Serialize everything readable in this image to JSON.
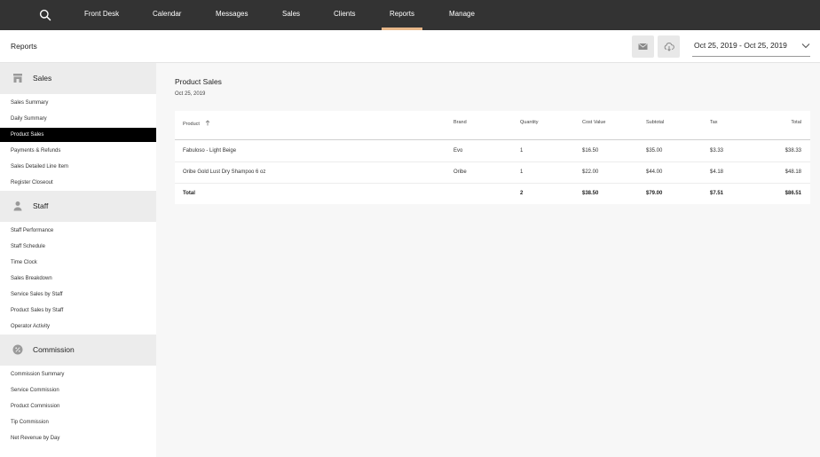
{
  "nav": {
    "items": [
      {
        "label": "Front Desk",
        "active": false
      },
      {
        "label": "Calendar",
        "active": false
      },
      {
        "label": "Messages",
        "active": false
      },
      {
        "label": "Sales",
        "active": false
      },
      {
        "label": "Clients",
        "active": false
      },
      {
        "label": "Reports",
        "active": true
      },
      {
        "label": "Manage",
        "active": false
      }
    ],
    "accent_color": "#e8b88a",
    "background_color": "#333333"
  },
  "header": {
    "title": "Reports",
    "date_range": "Oct 25, 2019 - Oct 25, 2019"
  },
  "sidebar": {
    "sections": [
      {
        "label": "Sales",
        "icon": "store-icon",
        "items": [
          "Sales Summary",
          "Daily Summary",
          "Product Sales",
          "Payments & Refunds",
          "Sales Detailed Line Item",
          "Register Closeout"
        ]
      },
      {
        "label": "Staff",
        "icon": "person-icon",
        "items": [
          "Staff Performance",
          "Staff Schedule",
          "Time Clock",
          "Sales Breakdown",
          "Service Sales by Staff",
          "Product Sales by Staff",
          "Operator Activity"
        ]
      },
      {
        "label": "Commission",
        "icon": "percent-icon",
        "items": [
          "Commission Summary",
          "Service Commission",
          "Product Commission",
          "Tip Commission",
          "Net Revenue by Day"
        ]
      }
    ],
    "active_item": "Product Sales"
  },
  "report": {
    "title": "Product Sales",
    "date": "Oct 25, 2019",
    "columns": [
      "Product",
      "Brand",
      "Quantity",
      "Cost Value",
      "Subtotal",
      "Tax",
      "Total"
    ],
    "rows": [
      [
        "Fabuloso - Light Beige",
        "Evo",
        "1",
        "$16.50",
        "$35.00",
        "$3.33",
        "$38.33"
      ],
      [
        "Oribe Gold Lust Dry Shampoo 6 oz",
        "Oribe",
        "1",
        "$22.00",
        "$44.00",
        "$4.18",
        "$48.18"
      ]
    ],
    "total_row": [
      "Total",
      "",
      "2",
      "$38.50",
      "$79.00",
      "$7.51",
      "$86.51"
    ]
  }
}
